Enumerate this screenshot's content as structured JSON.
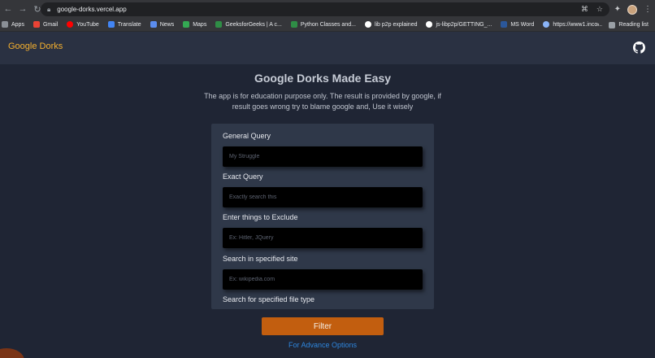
{
  "browser": {
    "url": "google-dorks.vercel.app",
    "bookmarks": [
      {
        "label": "Apps",
        "color": "#5f6368"
      },
      {
        "label": "Gmail",
        "color": "#ea4335"
      },
      {
        "label": "YouTube",
        "color": "#ff0000"
      },
      {
        "label": "Translate",
        "color": "#4285f4"
      },
      {
        "label": "News",
        "color": "#5b8def"
      },
      {
        "label": "Maps",
        "color": "#34a853"
      },
      {
        "label": "GeeksforGeeks | A c...",
        "color": "#2f8d46"
      },
      {
        "label": "Python Classes and...",
        "color": "#2f8d46"
      },
      {
        "label": "lib p2p explained",
        "color": "#ffffff"
      },
      {
        "label": "js-libp2p/GETTING_...",
        "color": "#ffffff"
      },
      {
        "label": "MS Word",
        "color": "#2b579a"
      },
      {
        "label": "https://www1.inco...",
        "color": "#8ab4f8"
      }
    ],
    "more": "»",
    "reading_list": "Reading list"
  },
  "app": {
    "brand": "Google Dorks",
    "title": "Google Dorks Made Easy",
    "subtitle": "The app is for education purpose only. The result is provided by google, if result goes wrong try to blame google and, Use it wisely",
    "fields": [
      {
        "label": "General Query",
        "placeholder": "My Struggle"
      },
      {
        "label": "Exact Query",
        "placeholder": "Exactly search this"
      },
      {
        "label": "Enter things to Exclude",
        "placeholder": "Ex: Hitler, JQuery"
      },
      {
        "label": "Search in specified site",
        "placeholder": "Ex: wikipedia.com"
      },
      {
        "label": "Search for specified file type",
        "placeholder": ""
      }
    ],
    "filter_label": "Filter",
    "advance_link": "For Advance Options"
  },
  "colors": {
    "brand": "#f5b02e",
    "button": "#c25e0f",
    "link": "#2e86de",
    "background": "#1f2534"
  }
}
